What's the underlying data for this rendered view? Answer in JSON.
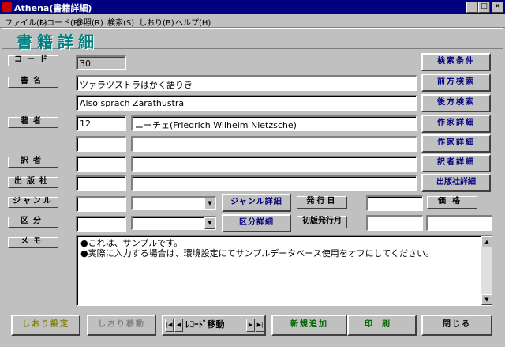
{
  "window": {
    "title": "Athena(書籍詳細)",
    "min_glyph": "_",
    "max_glyph": "□",
    "close_glyph": "×"
  },
  "menu": [
    "ファイル(F)",
    "レコード(R)",
    "参照(R)",
    "検索(S)",
    "しおり(B)",
    "ヘルプ(H)"
  ],
  "heading": "書籍詳細",
  "labels": {
    "code": "コード",
    "title": "書名",
    "author": "著者",
    "translator": "訳者",
    "publisher": "出版社",
    "genre": "ジャンル",
    "category": "区分",
    "memo": "メモ",
    "issue_date": "発行日",
    "price": "価格",
    "first_issue_month": "初版発行月"
  },
  "values": {
    "code": "30",
    "title": "ツァラツストラはかく語りき",
    "title_original": "Also sprach Zarathustra",
    "author_id": "12",
    "author_name": "ニーチェ(Friedrich Wilhelm Nietzsche)",
    "author2_id": "",
    "author2_name": "",
    "translator_id": "",
    "translator_name": "",
    "publisher_id": "",
    "publisher_name": "",
    "genre_code": "",
    "genre_select": "",
    "category_code": "",
    "category_select": "",
    "issue_date": "",
    "price": "",
    "first_issue_month": "",
    "memo_lines": [
      "●これは、サンプルです。",
      "●実際に入力する場合は、環境設定にてサンプルデータベース使用をオフにしてください。"
    ]
  },
  "right_buttons": {
    "search_cond": "検索条件",
    "prev_search": "前方検索",
    "next_search": "後方検索",
    "author_detail1": "作家詳細",
    "author_detail2": "作家詳細",
    "translator_detail": "訳者詳細",
    "publisher_detail": "出版社詳細"
  },
  "mid_buttons": {
    "genre_detail": "ジャンル詳細",
    "category_detail": "区分詳細"
  },
  "bottom": {
    "bookmark_set": "しおり設定",
    "bookmark_move": "しおり移動",
    "record_move": "ﾚｺｰﾄﾞ移動",
    "new_add": "新規追加",
    "print": "印刷",
    "close": "閉じる"
  },
  "colors": {
    "titlebar": "#000080",
    "heading": "#008080",
    "accent_button_text": "#000080",
    "bookmark_text": "#808000"
  }
}
